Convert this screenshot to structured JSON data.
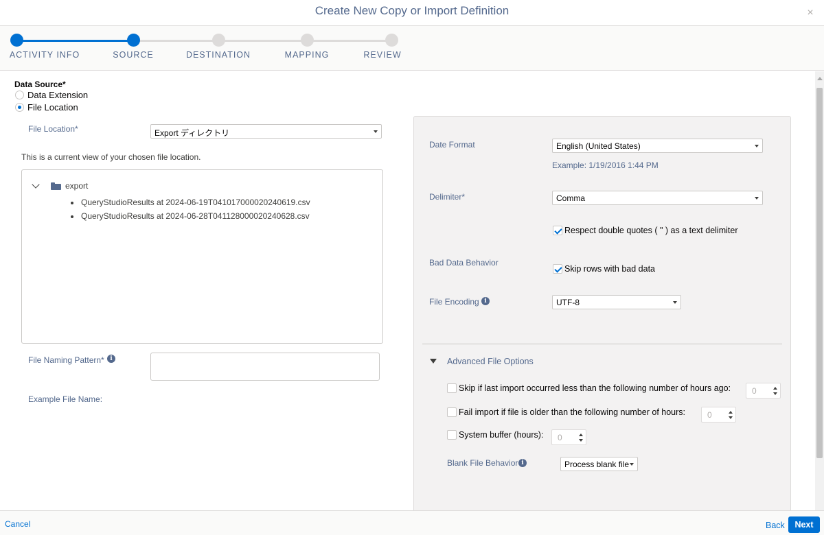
{
  "header": {
    "title": "Create New Copy or Import Definition",
    "close_icon": "×"
  },
  "stepper": {
    "steps": [
      {
        "label": "ACTIVITY INFO",
        "state": "complete"
      },
      {
        "label": "SOURCE",
        "state": "current"
      },
      {
        "label": "DESTINATION",
        "state": "upcoming"
      },
      {
        "label": "MAPPING",
        "state": "upcoming"
      },
      {
        "label": "REVIEW",
        "state": "upcoming"
      }
    ],
    "active_color": "#0070d2",
    "inactive_color": "#dddbda"
  },
  "source": {
    "data_source_label": "Data Source*",
    "options": [
      {
        "label": "Data Extension",
        "selected": false
      },
      {
        "label": "File Location",
        "selected": true
      }
    ],
    "file_location_label": "File Location*",
    "file_location_value": "Export ディレクトリ",
    "view_note": "This is a current view of your chosen file location.",
    "tree": {
      "folder": "export",
      "files": [
        "QueryStudioResults at 2024-06-19T041017000020240619.csv",
        "QueryStudioResults at 2024-06-28T041128000020240628.csv"
      ]
    },
    "file_naming_pattern_label": "File Naming Pattern*",
    "file_naming_pattern_value": "",
    "example_file_name_label": "Example File Name:"
  },
  "options_panel": {
    "date_format_label": "Date Format",
    "date_format_value": "English (United States)",
    "date_example": "Example: 1/19/2016 1:44 PM",
    "delimiter_label": "Delimiter*",
    "delimiter_value": "Comma",
    "respect_quotes_label": "Respect double quotes ( \" ) as a text delimiter",
    "respect_quotes_checked": true,
    "bad_data_label": "Bad Data Behavior",
    "skip_bad_rows_label": "Skip rows with bad data",
    "skip_bad_rows_checked": true,
    "file_encoding_label": "File Encoding",
    "file_encoding_value": "UTF-8",
    "advanced_label": "Advanced File Options",
    "skip_if_label": "Skip if last import occurred less than the following number of hours ago:",
    "skip_if_value": "0",
    "fail_import_label": "Fail import if file is older than the following number of hours:",
    "fail_import_value": "0",
    "system_buffer_label": "System buffer (hours):",
    "system_buffer_value": "0",
    "blank_file_label": "Blank File Behavior",
    "blank_file_value": "Process blank file"
  },
  "footer": {
    "cancel": "Cancel",
    "back": "Back",
    "next": "Next"
  }
}
